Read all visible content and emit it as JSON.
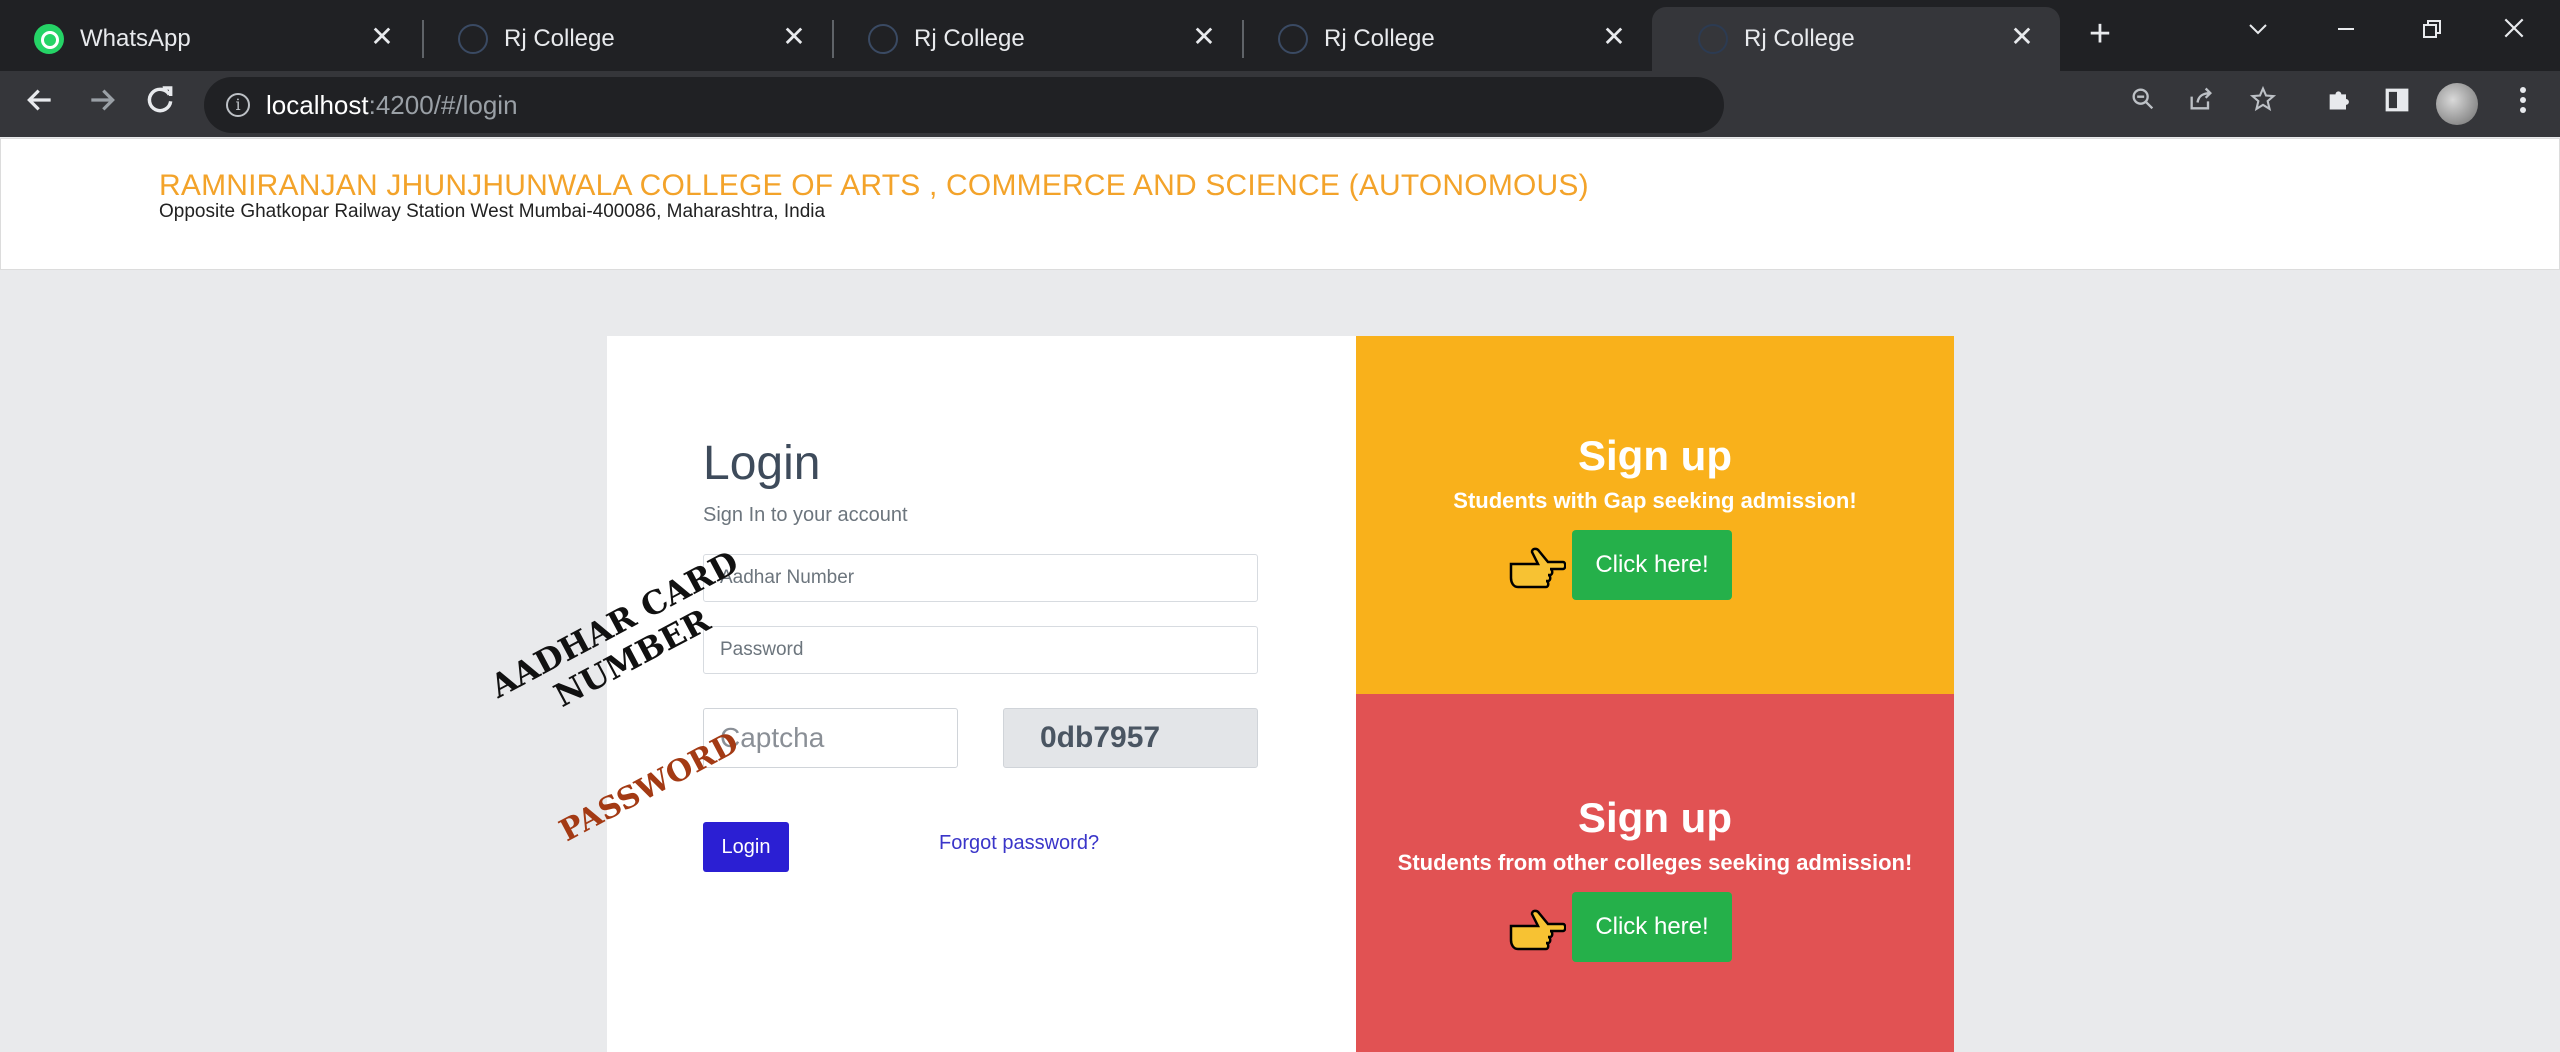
{
  "browser": {
    "tabs": [
      {
        "label": "WhatsApp",
        "icon": "whatsapp-icon",
        "active": false
      },
      {
        "label": "Rj College",
        "icon": "rj-college-favicon",
        "active": false
      },
      {
        "label": "Rj College",
        "icon": "rj-college-favicon",
        "active": false
      },
      {
        "label": "Rj College",
        "icon": "rj-college-favicon",
        "active": false
      },
      {
        "label": "Rj College",
        "icon": "rj-college-favicon",
        "active": true
      }
    ],
    "close_glyph": "✕",
    "new_tab_glyph": "+",
    "address": {
      "host": "localhost",
      "path": ":4200/#/login"
    }
  },
  "header": {
    "college_name": "RAMNIRANJAN JHUNJHUNWALA COLLEGE OF ARTS , COMMERCE AND SCIENCE (AUTONOMOUS)",
    "address": "Opposite Ghatkopar Railway Station West Mumbai-400086, Maharashtra, India",
    "name_color": "#f3a32a"
  },
  "login": {
    "title": "Login",
    "subtitle": "Sign In to your account",
    "aadhar_placeholder": "Aadhar Number",
    "password_placeholder": "Password",
    "captcha_placeholder": "Captcha",
    "captcha_code": "0db7957",
    "login_button": "Login",
    "forgot_link": "Forgot password?",
    "button_color": "#2b1fd3"
  },
  "signup": [
    {
      "title": "Sign up",
      "subtitle": "Students with Gap seeking admission!",
      "button": "Click here!",
      "color": "#f9b11b"
    },
    {
      "title": "Sign up",
      "subtitle": "Students from other colleges seeking admission!",
      "button": "Click here!",
      "color": "#e15253"
    }
  ],
  "annotations": {
    "aadhar_line1": "AADHAR CARD",
    "aadhar_line2": "NUMBER",
    "password": "PASSWORD"
  }
}
